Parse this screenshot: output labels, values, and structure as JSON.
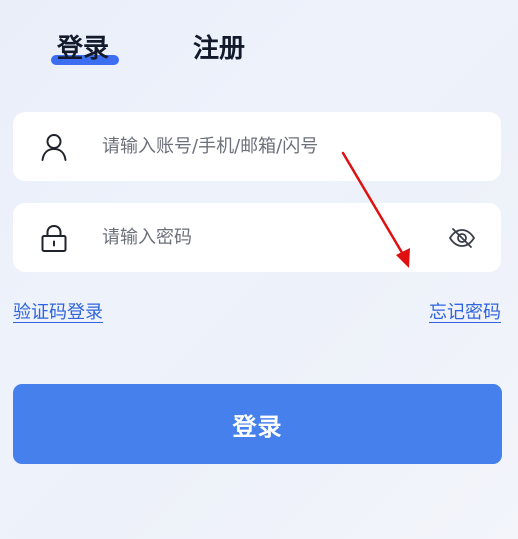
{
  "tabs": {
    "login_label": "登录",
    "register_label": "注册",
    "active": "login"
  },
  "account_field": {
    "placeholder": "请输入账号/手机/邮箱/闪号",
    "value": "",
    "icon": "user-icon"
  },
  "password_field": {
    "placeholder": "请输入密码",
    "value": "",
    "icon": "lock-icon",
    "toggle_icon": "eye-slash-icon"
  },
  "links": {
    "sms_login": "验证码登录",
    "forgot_password": "忘记密码"
  },
  "submit": {
    "label": "登录"
  },
  "colors": {
    "accent": "#4580ec",
    "tab_underline": "#3d6df0",
    "link": "#2f64dd",
    "annotation_arrow": "#e01010"
  }
}
